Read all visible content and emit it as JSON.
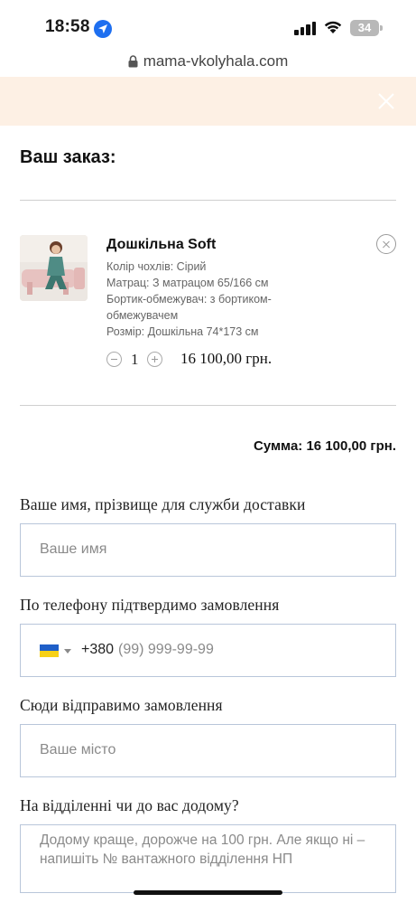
{
  "status_bar": {
    "time": "18:58",
    "battery": "34"
  },
  "browser": {
    "url": "mama-vkolyhala.com"
  },
  "order": {
    "title": "Ваш заказ:",
    "item": {
      "name": "Дошкільна Soft",
      "attributes": [
        "Колір чохлів: Сірий",
        "Матрац: З матрацом 65/166 см",
        "Бортик-обмежувач: з бортиком-",
        "обмежувачем",
        "Розмір: Дошкільна 74*173 см"
      ],
      "quantity": "1",
      "price": "16 100,00 грн."
    },
    "total": "Сумма: 16 100,00 грн."
  },
  "form": {
    "name": {
      "label": "Ваше имя, прізвище для служби доставки",
      "placeholder": "Ваше имя"
    },
    "phone": {
      "label": "По телефону підтвердимо замовлення",
      "prefix": "+380",
      "placeholder": "(99) 999-99-99",
      "country_icon": "ukraine-flag-icon"
    },
    "city": {
      "label": "Сюди відправимо замовлення",
      "placeholder": "Ваше місто"
    },
    "delivery": {
      "label": "На відділенні чи до вас додому?",
      "placeholder": "Додому краще, дорожче на 100 грн. Але якщо ні – напишіть № вантажного відділення НП"
    }
  },
  "colors": {
    "banner": "#fdf0e4",
    "field_border": "#b9c6da",
    "nav_accent": "#1e6ff0"
  }
}
